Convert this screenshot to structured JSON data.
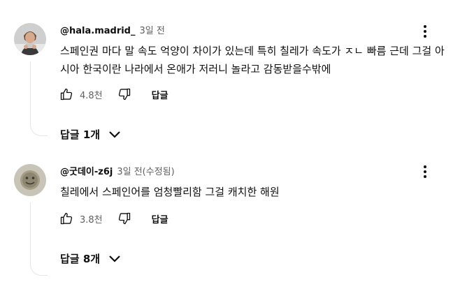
{
  "comments": [
    {
      "author": "@hala.madrid_",
      "time": "3일 전",
      "text": "스페인권 마다 말 속도 억양이 차이가 있는데 특히 칠레가 속도가 ㅈㄴ 빠름 근데 그걸  아시아 한국이란 나라에서 온애가 저러니 놀라고 감동받을수밖에",
      "likes": "4.8천",
      "reply_label": "답글",
      "replies_toggle": "답글 1개"
    },
    {
      "author": "@굿데이-z6j",
      "time": "3일 전(수정됨)",
      "text": "칠레에서 스페인어를 엄청빨리함 그걸 캐치한 해원",
      "likes": "3.8천",
      "reply_label": "답글",
      "replies_toggle": "답글 8개"
    }
  ],
  "colors": {
    "text_primary": "#0f0f0f",
    "text_secondary": "#606060",
    "thread_line": "#e5e5e5"
  },
  "icons": {
    "like": "thumbs-up-icon",
    "dislike": "thumbs-down-icon",
    "more": "more-vert-icon",
    "chevron": "chevron-down-icon"
  }
}
